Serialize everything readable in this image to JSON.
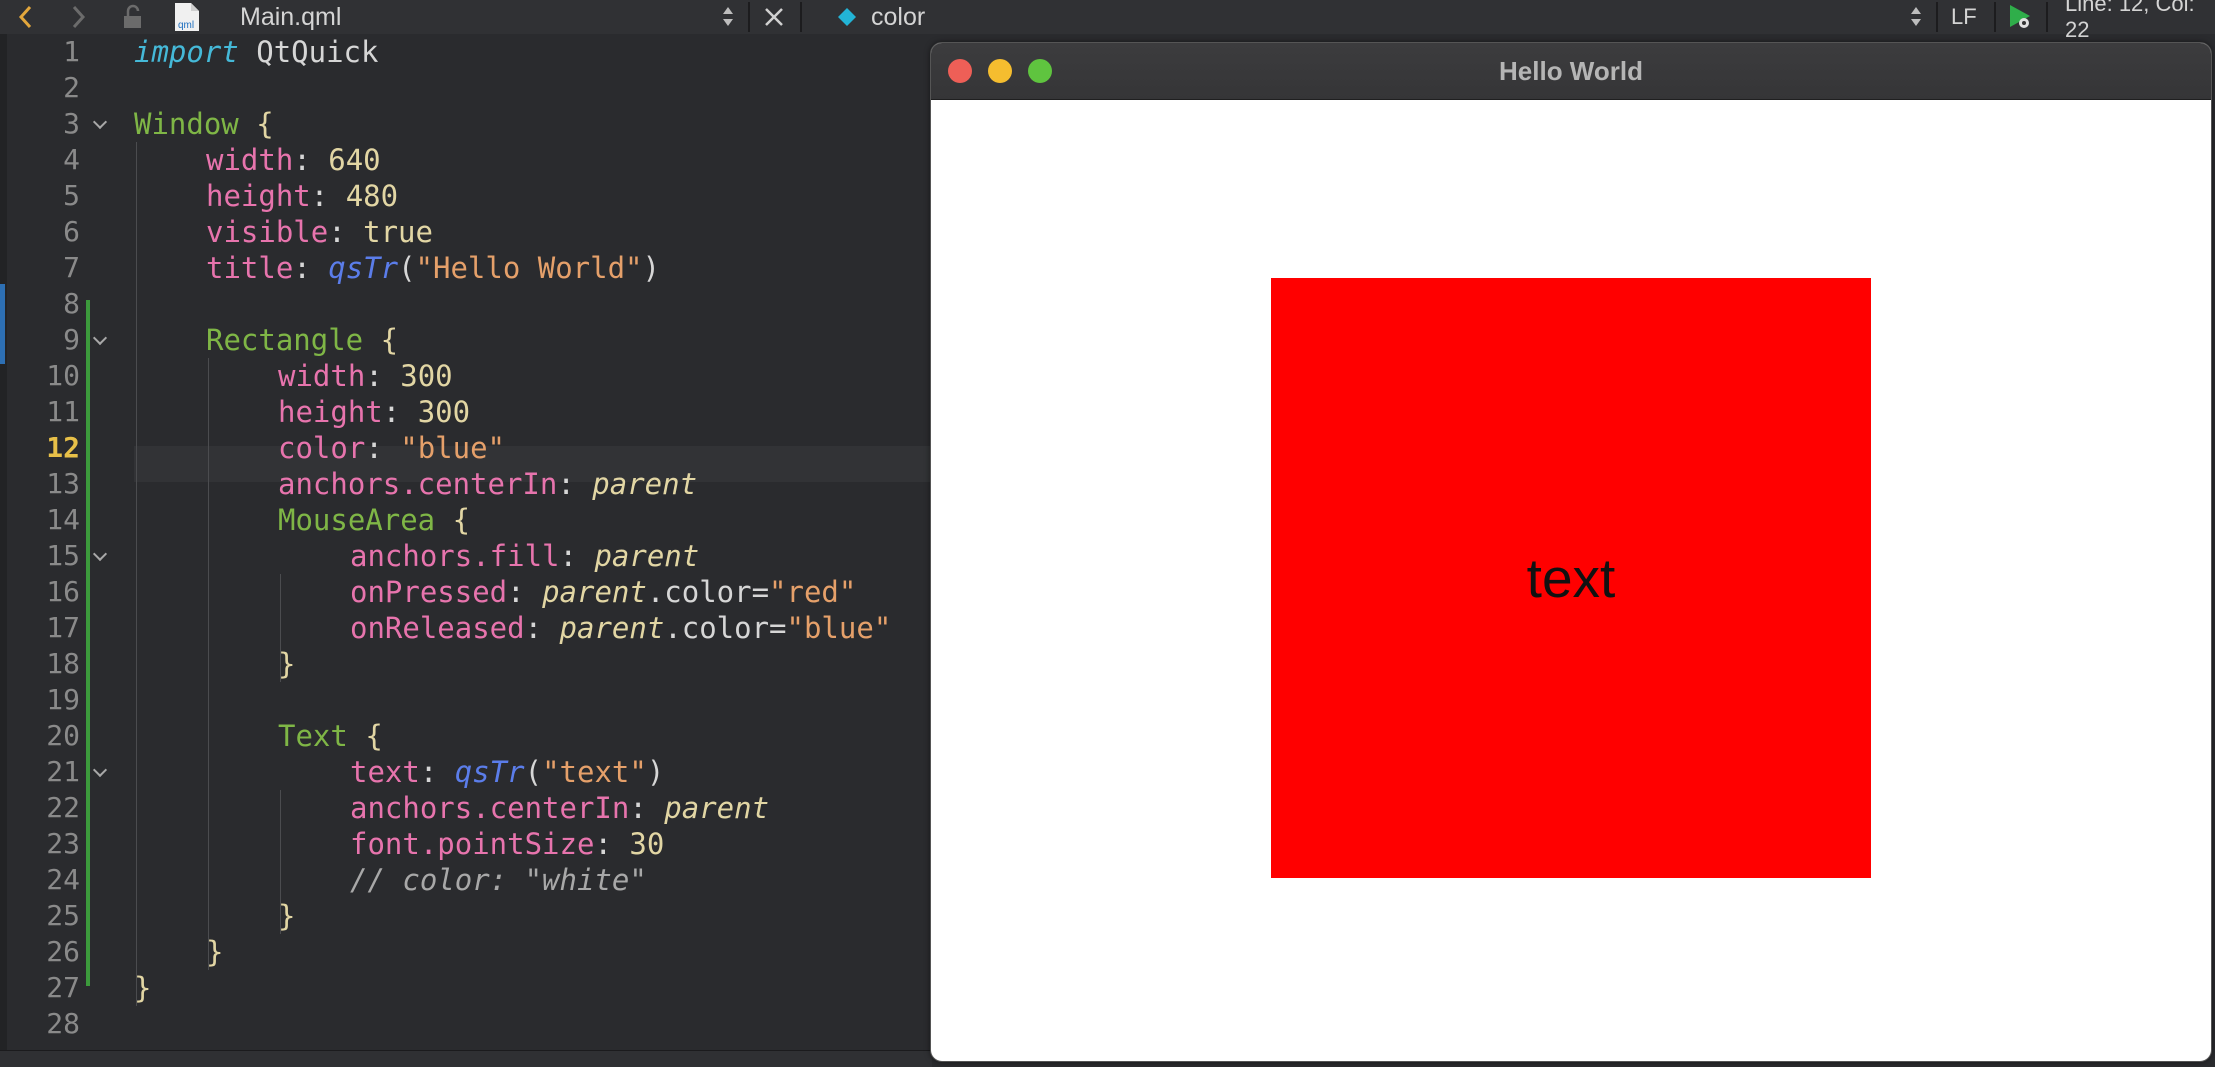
{
  "toolbar": {
    "file_name": "Main.qml",
    "file_icon_label": "qml",
    "symbol": "color",
    "line_ending": "LF",
    "cursor_position": "Line: 12, Col: 22"
  },
  "editor": {
    "current_line": 12,
    "line_numbers": [
      "1",
      "2",
      "3",
      "4",
      "5",
      "6",
      "7",
      "8",
      "9",
      "10",
      "11",
      "12",
      "13",
      "14",
      "15",
      "16",
      "17",
      "18",
      "19",
      "20",
      "21",
      "22",
      "23",
      "24",
      "25",
      "26",
      "27",
      "28"
    ]
  },
  "app_window": {
    "title": "Hello World",
    "rect_color": "#ff0000",
    "rect_text": "text",
    "traffic_lights": [
      "#ee5f57",
      "#f5bd2f",
      "#5fc43f"
    ]
  },
  "colors": {
    "editor_bg": "#2a2b2e",
    "keyword_type": "#7fb646",
    "property": "#e774ad",
    "string": "#e5a06a",
    "function": "#5b7dea"
  }
}
